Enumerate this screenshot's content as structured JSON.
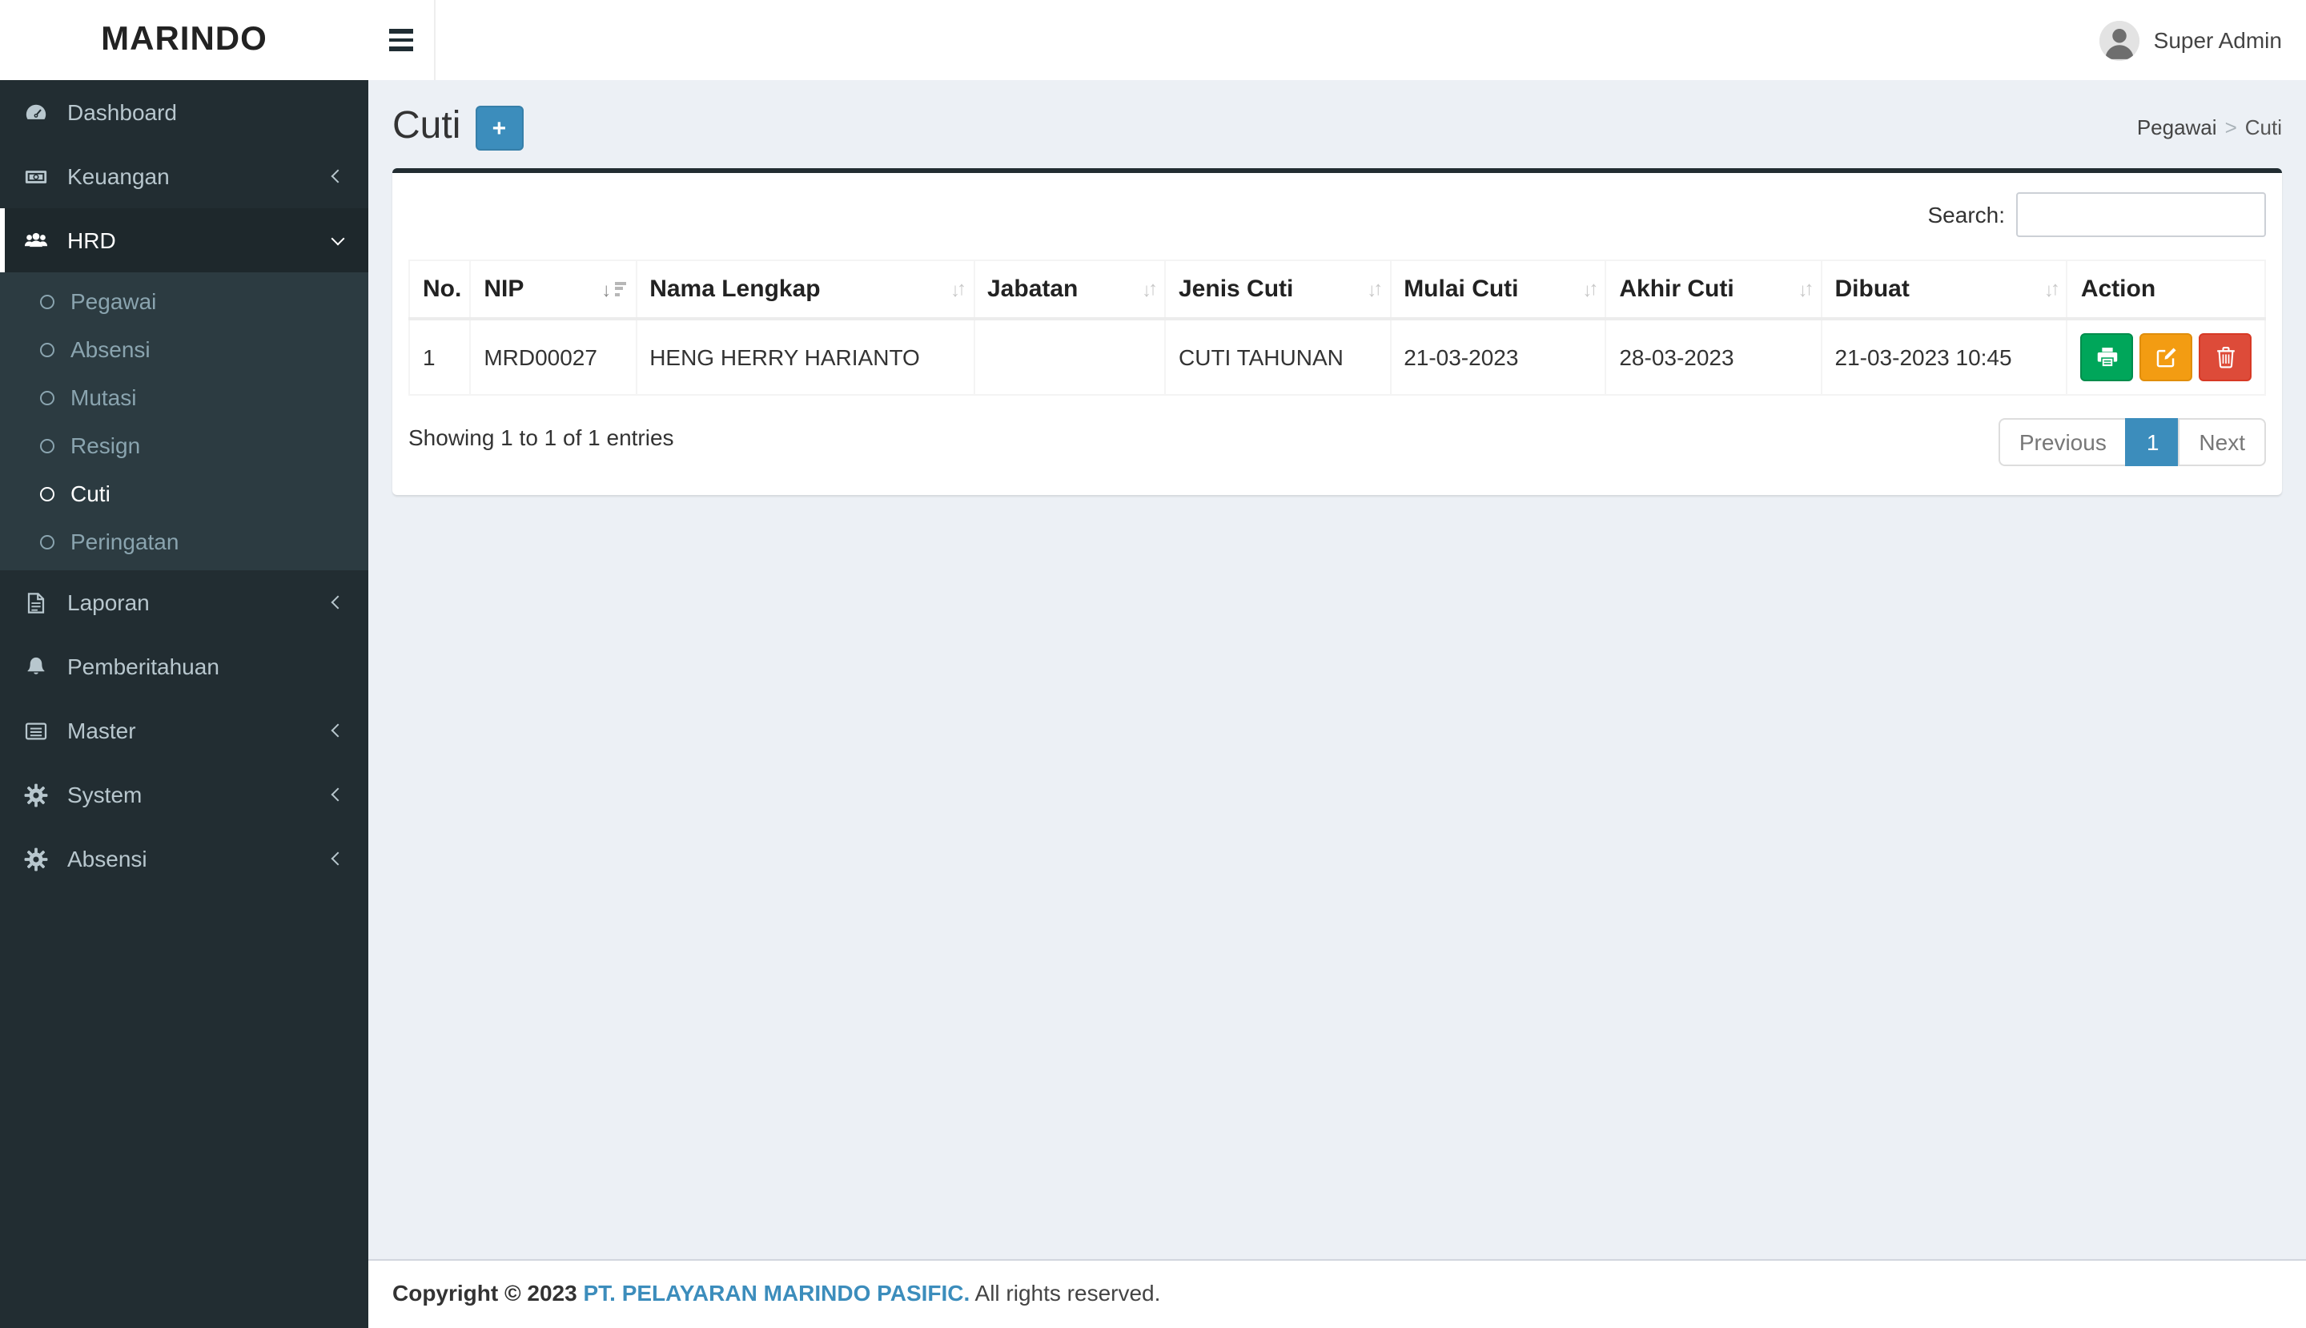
{
  "colors": {
    "accent": "#3c8dbc",
    "sidebar_bg": "#222d32",
    "sidebar_active_bg": "#1e282c",
    "submenu_bg": "#2c3b41",
    "content_bg": "#ecf0f5",
    "box_top_border": "#222d32",
    "success": "#00a65a",
    "warning": "#f39c12",
    "danger": "#dd4b39",
    "laravel_red": "#ff2d20"
  },
  "header": {
    "brand": "MARINDO",
    "user_name": "Super Admin"
  },
  "sidebar": {
    "items": [
      {
        "label": "Dashboard"
      },
      {
        "label": "Keuangan"
      },
      {
        "label": "HRD",
        "children": [
          "Pegawai",
          "Absensi",
          "Mutasi",
          "Resign",
          "Cuti",
          "Peringatan"
        ]
      },
      {
        "label": "Laporan"
      },
      {
        "label": "Pemberitahuan"
      },
      {
        "label": "Master"
      },
      {
        "label": "System"
      },
      {
        "label": "Absensi"
      }
    ]
  },
  "page": {
    "title": "Cuti",
    "add_button_label": "+",
    "breadcrumb": {
      "parent": "Pegawai",
      "separator": ">",
      "current": "Cuti"
    }
  },
  "table": {
    "search_label": "Search:",
    "search_value": "",
    "columns": [
      "No.",
      "NIP",
      "Nama Lengkap",
      "Jabatan",
      "Jenis Cuti",
      "Mulai Cuti",
      "Akhir Cuti",
      "Dibuat",
      "Action"
    ],
    "rows": [
      {
        "no": "1",
        "nip": "MRD00027",
        "nama_lengkap": "HENG HERRY HARIANTO",
        "jabatan": "",
        "jenis_cuti": "CUTI TAHUNAN",
        "mulai_cuti": "21-03-2023",
        "akhir_cuti": "28-03-2023",
        "dibuat": "21-03-2023 10:45"
      }
    ],
    "info": "Showing 1 to 1 of 1 entries",
    "pagination": {
      "previous": "Previous",
      "current_page": "1",
      "next": "Next"
    }
  },
  "footer": {
    "copyright": "Copyright © 2023",
    "company": "PT. PELAYARAN MARINDO PASIFIC.",
    "rights": "All rights reserved."
  }
}
